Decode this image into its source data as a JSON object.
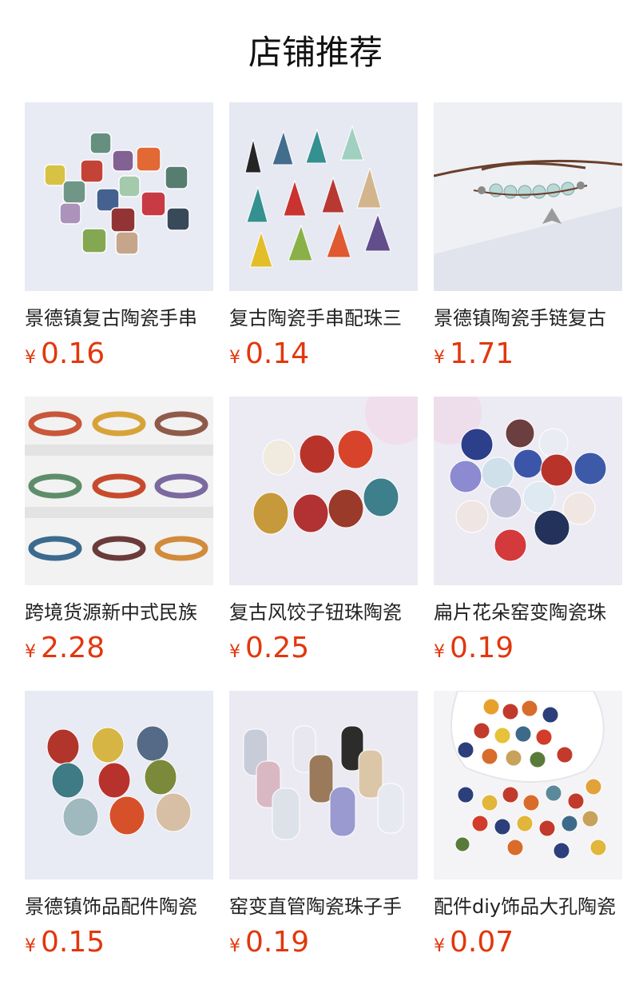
{
  "header": {
    "title": "店铺推荐"
  },
  "products": [
    {
      "title": "景德镇复古陶瓷手串",
      "currency": "¥",
      "price": "0.16",
      "image": "square-ceramic-beads"
    },
    {
      "title": "复古陶瓷手串配珠三",
      "currency": "¥",
      "price": "0.14",
      "image": "triangle-ceramic-beads"
    },
    {
      "title": "景德镇陶瓷手链复古",
      "currency": "¥",
      "price": "1.71",
      "image": "butterfly-bracelet"
    },
    {
      "title": "跨境货源新中式民族",
      "currency": "¥",
      "price": "2.28",
      "image": "bracelet-collection"
    },
    {
      "title": "复古风饺子钮珠陶瓷",
      "currency": "¥",
      "price": "0.25",
      "image": "dumpling-knot-beads"
    },
    {
      "title": "扁片花朵窑变陶瓷珠",
      "currency": "¥",
      "price": "0.19",
      "image": "flower-ceramic-beads"
    },
    {
      "title": "景德镇饰品配件陶瓷",
      "currency": "¥",
      "price": "0.15",
      "image": "heart-ceramic-beads"
    },
    {
      "title": "窑变直管陶瓷珠子手",
      "currency": "¥",
      "price": "0.19",
      "image": "tube-ceramic-beads"
    },
    {
      "title": "配件diy饰品大孔陶瓷",
      "currency": "¥",
      "price": "0.07",
      "image": "round-ceramic-beads"
    }
  ],
  "colors": {
    "price": "#e2370d",
    "title_text": "#222222"
  }
}
